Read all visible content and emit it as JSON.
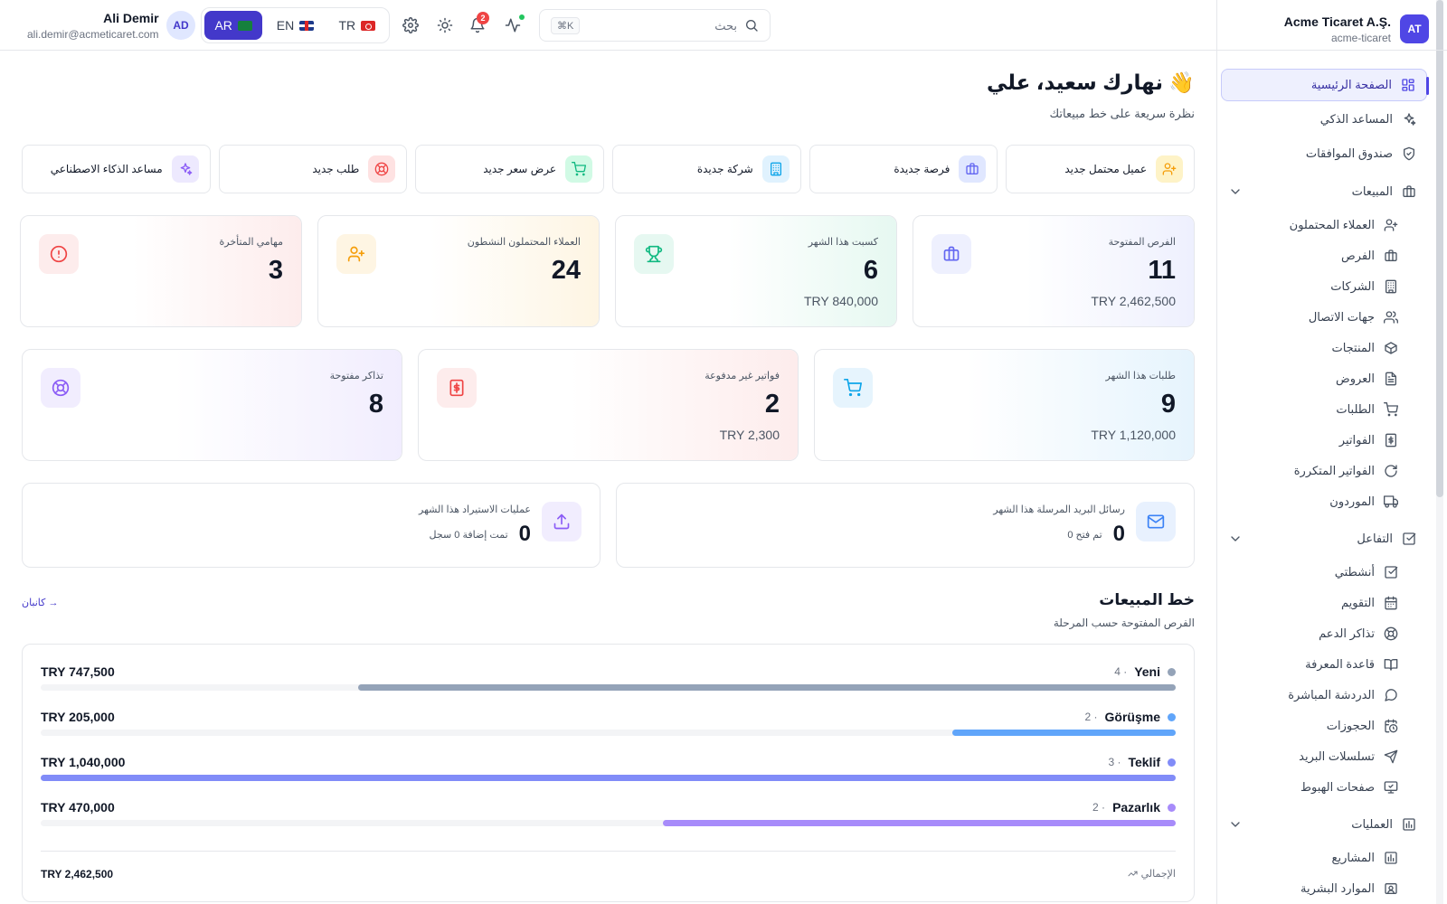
{
  "org": {
    "name": "Acme Ticaret A.Ş.",
    "slug": "acme-ticaret",
    "avatar": "AT"
  },
  "user": {
    "name": "Ali Demir",
    "email": "ali.demir@acmeticaret.com",
    "avatar": "AD"
  },
  "languages": [
    {
      "code": "AR",
      "active": true
    },
    {
      "code": "EN",
      "active": false
    },
    {
      "code": "TR",
      "active": false
    }
  ],
  "notifications": {
    "count": "2"
  },
  "search": {
    "placeholder": "بحث",
    "shortcut": "⌘K"
  },
  "sidebar": {
    "top": [
      {
        "label": "الصفحة الرئيسية",
        "icon": "dashboard-icon",
        "active": true
      },
      {
        "label": "المساعد الذكي",
        "icon": "sparkles-icon"
      },
      {
        "label": "صندوق الموافقات",
        "icon": "shield-check-icon"
      }
    ],
    "groups": [
      {
        "label": "المبيعات",
        "icon": "briefcase-icon",
        "items": [
          {
            "label": "العملاء المحتملون",
            "icon": "user-plus-icon"
          },
          {
            "label": "الفرص",
            "icon": "briefcase-icon"
          },
          {
            "label": "الشركات",
            "icon": "building-icon"
          },
          {
            "label": "جهات الاتصال",
            "icon": "users-icon"
          },
          {
            "label": "المنتجات",
            "icon": "box-icon"
          },
          {
            "label": "العروض",
            "icon": "file-text-icon"
          },
          {
            "label": "الطلبات",
            "icon": "cart-icon"
          },
          {
            "label": "الفواتير",
            "icon": "invoice-icon"
          },
          {
            "label": "الفواتير المتكررة",
            "icon": "refresh-icon"
          },
          {
            "label": "الموردون",
            "icon": "truck-icon"
          }
        ]
      },
      {
        "label": "التفاعل",
        "icon": "check-square-icon",
        "items": [
          {
            "label": "أنشطتي",
            "icon": "check-square-icon"
          },
          {
            "label": "التقويم",
            "icon": "calendar-icon"
          },
          {
            "label": "تذاكر الدعم",
            "icon": "life-buoy-icon"
          },
          {
            "label": "قاعدة المعرفة",
            "icon": "book-icon"
          },
          {
            "label": "الدردشة المباشرة",
            "icon": "chat-icon"
          },
          {
            "label": "الحجوزات",
            "icon": "calendar-clock-icon"
          },
          {
            "label": "تسلسلات البريد",
            "icon": "send-icon"
          },
          {
            "label": "صفحات الهبوط",
            "icon": "monitor-icon"
          }
        ]
      },
      {
        "label": "العمليات",
        "icon": "chart-icon",
        "items": [
          {
            "label": "المشاريع",
            "icon": "chart-icon"
          },
          {
            "label": "الموارد البشرية",
            "icon": "id-card-icon"
          }
        ]
      }
    ]
  },
  "main": {
    "greeting": "نهارك سعيد، علي 👋",
    "subtitle": "نظرة سريعة على خط مبيعاتك",
    "quick_actions": [
      {
        "label": "عميل محتمل جديد",
        "icon": "user-plus-icon",
        "color": "#f59e0b",
        "bg": "#fef3c7"
      },
      {
        "label": "فرصة جديدة",
        "icon": "briefcase-icon",
        "color": "#6366f1",
        "bg": "#e0e7ff"
      },
      {
        "label": "شركة جديدة",
        "icon": "building-icon",
        "color": "#0ea5e9",
        "bg": "#e0f2fe"
      },
      {
        "label": "عرض سعر جديد",
        "icon": "cart-icon",
        "color": "#10b981",
        "bg": "#d1fae5"
      },
      {
        "label": "طلب جديد",
        "icon": "life-buoy-icon",
        "color": "#ef4444",
        "bg": "#fee2e2"
      },
      {
        "label": "مساعد الذكاء الاصطناعي",
        "icon": "sparkles-icon",
        "color": "#8b5cf6",
        "bg": "#ede9fe"
      }
    ],
    "stats_row1": [
      {
        "label": "الفرص المفتوحة",
        "value": "11",
        "sub": "TRY 2,462,500",
        "icon": "briefcase-icon",
        "color": "#6366f1",
        "bg": "#eef0fe"
      },
      {
        "label": "كسبت هذا الشهر",
        "value": "6",
        "sub": "TRY 840,000",
        "icon": "trophy-icon",
        "color": "#10b981",
        "bg": "#e6f8f1"
      },
      {
        "label": "العملاء المحتملون النشطون",
        "value": "24",
        "sub": "",
        "icon": "user-plus-icon",
        "color": "#f59e0b",
        "bg": "#fef5e3"
      },
      {
        "label": "مهامي المتأخرة",
        "value": "3",
        "sub": "",
        "icon": "alert-icon",
        "color": "#ef4444",
        "bg": "#fdecec"
      }
    ],
    "stats_row2": [
      {
        "label": "طلبات هذا الشهر",
        "value": "9",
        "sub": "TRY 1,120,000",
        "icon": "cart-icon",
        "color": "#0ea5e9",
        "bg": "#e6f4fd"
      },
      {
        "label": "فواتير غير مدفوعة",
        "value": "2",
        "sub": "TRY 2,300",
        "icon": "invoice-icon",
        "color": "#ef4444",
        "bg": "#fdecec"
      },
      {
        "label": "تذاكر مفتوحة",
        "value": "8",
        "sub": "",
        "icon": "life-buoy-icon",
        "color": "#8b5cf6",
        "bg": "#f1edfe"
      }
    ],
    "mini_stats": [
      {
        "label": "رسائل البريد المرسلة هذا الشهر",
        "value": "0",
        "sub": "تم فتح 0",
        "icon": "mail-icon",
        "color": "#3b82f6",
        "bg": "#e8f1fe"
      },
      {
        "label": "عمليات الاستيراد هذا الشهر",
        "value": "0",
        "sub": "تمت إضافة 0 سجل",
        "icon": "upload-icon",
        "color": "#8b5cf6",
        "bg": "#f1edfe"
      }
    ],
    "pipeline": {
      "title": "خط المبيعات",
      "subtitle": "الفرص المفتوحة حسب المرحلة",
      "link": "كانبان →",
      "stages": [
        {
          "name": "Yeni",
          "count": "4 ·",
          "amount": "TRY 747,500",
          "share": 0.72,
          "color": "#94a3b8"
        },
        {
          "name": "Görüşme",
          "count": "2 ·",
          "amount": "TRY 205,000",
          "share": 0.197,
          "color": "#60a5fa"
        },
        {
          "name": "Teklif",
          "count": "3 ·",
          "amount": "TRY 1,040,000",
          "share": 1.0,
          "color": "#818cf8"
        },
        {
          "name": "Pazarlık",
          "count": "2 ·",
          "amount": "TRY 470,000",
          "share": 0.452,
          "color": "#a78bfa"
        }
      ],
      "total_label": "الإجمالي",
      "total_amount": "TRY 2,462,500"
    }
  }
}
